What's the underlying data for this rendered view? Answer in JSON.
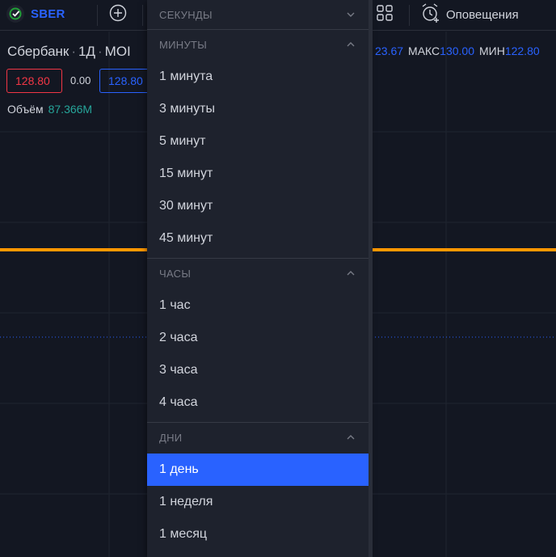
{
  "toolbar": {
    "symbol": "SBER",
    "alerts_label": "Оповещения"
  },
  "legend": {
    "title_name": "Сбербанк",
    "title_interval": "1Д",
    "title_exchange": "MOI",
    "ohlc_partial_value": "23.67",
    "high_label": "МАКС",
    "high_value": "130.00",
    "low_label": "МИН",
    "low_value": "122.80",
    "sell_price": "128.80",
    "spread": "0.00",
    "buy_price": "128.80",
    "volume_label": "Объём",
    "volume_value": "87.366M"
  },
  "chart": {
    "price_line_color": "#ff9800",
    "dotted_line_color": "#2962ff"
  },
  "dropdown": {
    "sections": [
      {
        "title": "СЕКУНДЫ",
        "expanded": false,
        "items": []
      },
      {
        "title": "МИНУТЫ",
        "expanded": true,
        "items": [
          "1 минута",
          "3 минуты",
          "5 минут",
          "15 минут",
          "30 минут",
          "45 минут"
        ]
      },
      {
        "title": "ЧАСЫ",
        "expanded": true,
        "items": [
          "1 час",
          "2 часа",
          "3 часа",
          "4 часа"
        ]
      },
      {
        "title": "ДНИ",
        "expanded": true,
        "items": [
          "1 день",
          "1 неделя",
          "1 месяц"
        ]
      }
    ],
    "selected": "1 день",
    "accent_color": "#2962ff"
  }
}
